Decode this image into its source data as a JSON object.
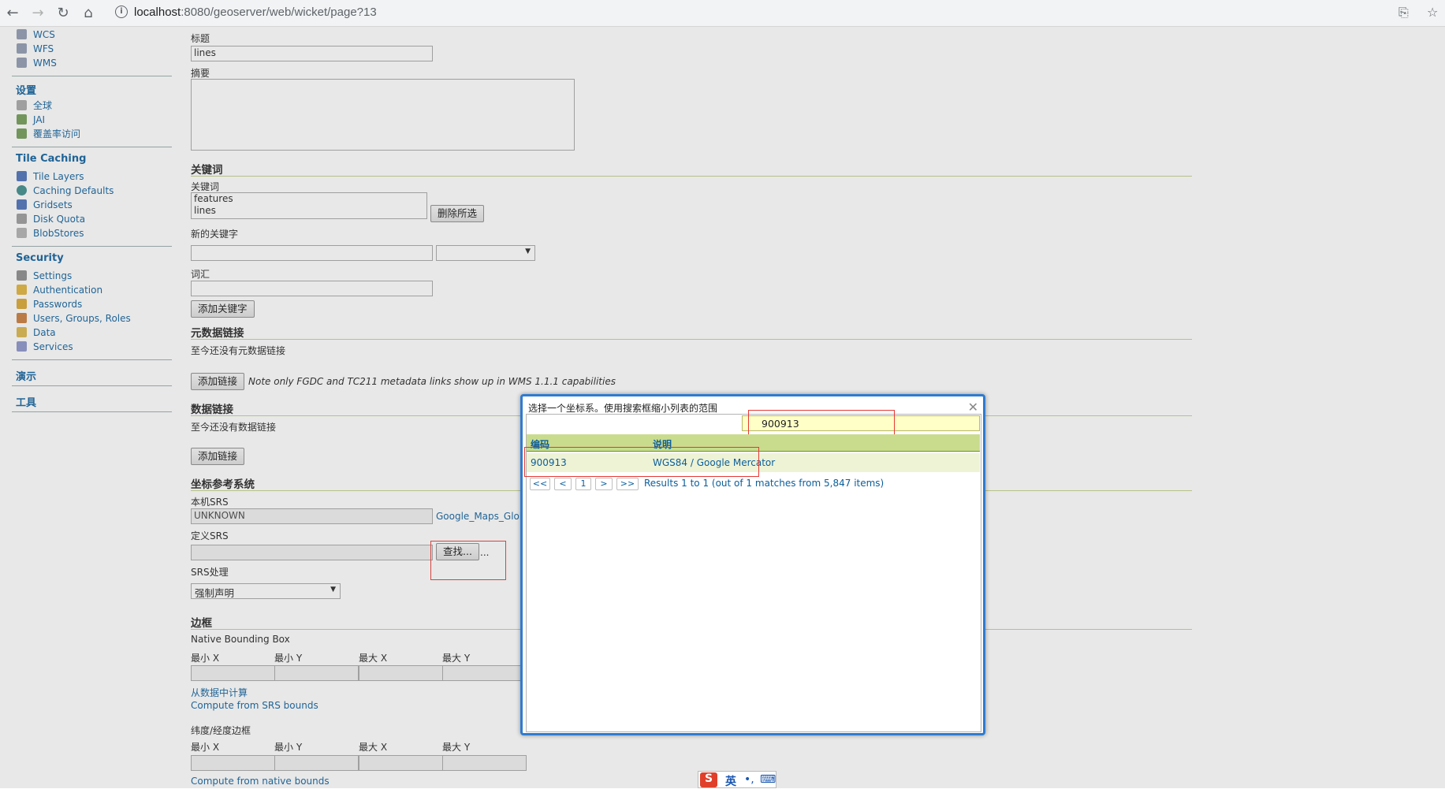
{
  "browser": {
    "back_icon": "arrow-left-icon",
    "url_host": "localhost",
    "url_path": ":8080/geoserver/web/wicket/page?13"
  },
  "sidebar": {
    "items_top": [
      "WCS",
      "WFS",
      "WMS"
    ],
    "settings_header": "设置",
    "settings_items": [
      "全球",
      "JAI",
      "覆盖率访问"
    ],
    "tile_header": "Tile Caching",
    "tile_items": [
      "Tile Layers",
      "Caching Defaults",
      "Gridsets",
      "Disk Quota",
      "BlobStores"
    ],
    "security_header": "Security",
    "security_items": [
      "Settings",
      "Authentication",
      "Passwords",
      "Users, Groups, Roles",
      "Data",
      "Services"
    ],
    "demo_header": "演示",
    "tools_header": "工具"
  },
  "form": {
    "title_label": "标题",
    "title_value": "lines",
    "abstract_label": "摘要",
    "keywords_section": "关键词",
    "keywords_label": "关键词",
    "keywords": [
      "features",
      "lines"
    ],
    "delete_selected": "删除所选",
    "new_keyword_label": "新的关键字",
    "vocab_label": "词汇",
    "add_keyword": "添加关键字",
    "metadata_section": "元数据链接",
    "no_metadata": "至今还没有元数据链接",
    "add_link": "添加链接",
    "metadata_note": "Note only FGDC and TC211 metadata links show up in WMS 1.1.1 capabilities",
    "data_links_section": "数据链接",
    "no_data_links": "至今还没有数据链接",
    "add_link2": "添加链接",
    "crs_section": "坐标参考系统",
    "native_srs_label": "本机SRS",
    "native_srs_value": "UNKNOWN",
    "native_srs_link": "Google_Maps_Globa",
    "declared_srs_label": "定义SRS",
    "find_button": "查找...",
    "find_dots": "...",
    "srs_handling_label": "SRS处理",
    "srs_handling_value": "强制声明",
    "bbox_section": "边框",
    "native_bbox_label": "Native Bounding Box",
    "minx": "最小 X",
    "miny": "最小 Y",
    "maxx": "最大 X",
    "maxy": "最大 Y",
    "compute_from_data": "从数据中计算",
    "compute_from_srs": "Compute from SRS bounds",
    "latlon_bbox_label": "纬度/经度边框",
    "compute_from_native": "Compute from native bounds"
  },
  "dialog": {
    "title": "选择一个坐标系。使用搜索框缩小列表的范围",
    "search_value": "900913",
    "col_code": "编码",
    "col_desc": "说明",
    "rows": [
      {
        "code": "900913",
        "desc": "WGS84 / Google Mercator"
      }
    ],
    "pager": [
      "<<",
      "<",
      "1",
      ">",
      ">>"
    ],
    "results_text": "Results 1 to 1 (out of 1 matches from 5,847 items)"
  },
  "ime": {
    "lang": "英",
    "punct": "•,"
  }
}
